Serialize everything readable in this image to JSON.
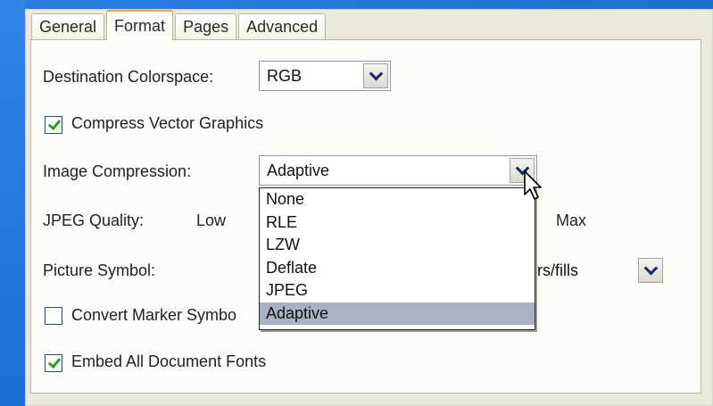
{
  "tabs": [
    "General",
    "Format",
    "Pages",
    "Advanced"
  ],
  "active_tab": "Format",
  "destination_colorspace": {
    "label": "Destination Colorspace:",
    "value": "RGB"
  },
  "compress_vector": {
    "label": "Compress Vector Graphics",
    "checked": true
  },
  "image_compression": {
    "label": "Image Compression:",
    "value": "Adaptive",
    "options": [
      "None",
      "RLE",
      "LZW",
      "Deflate",
      "JPEG",
      "Adaptive"
    ],
    "selected": "Adaptive"
  },
  "jpeg_quality": {
    "label": "JPEG Quality:",
    "low": "Low",
    "max": "Max"
  },
  "picture_symbol": {
    "label": "Picture Symbol:",
    "value_visible": "kers/fills"
  },
  "convert_marker": {
    "label_visible": "Convert Marker Symbo",
    "checked": false
  },
  "embed_fonts": {
    "label": "Embed All Document Fonts",
    "checked": true
  }
}
